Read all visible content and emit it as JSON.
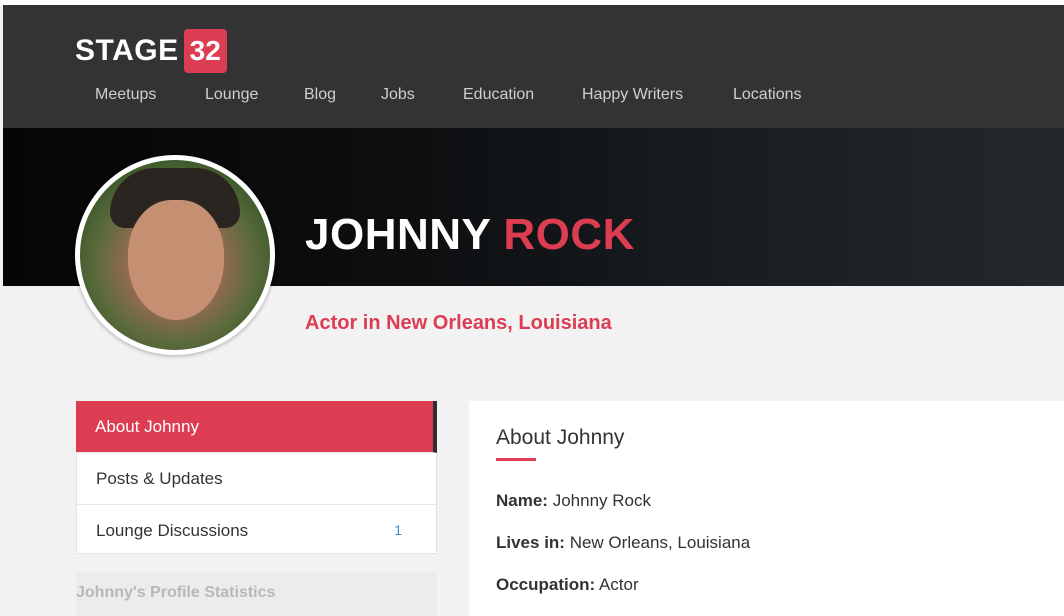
{
  "brand": {
    "word": "STAGE",
    "number": "32",
    "accent": "#dc3d52"
  },
  "nav": [
    "Meetups",
    "Lounge",
    "Blog",
    "Jobs",
    "Education",
    "Happy Writers",
    "Locations"
  ],
  "profile": {
    "first_name": "JOHNNY",
    "last_name": "ROCK",
    "tagline": "Actor in New Orleans, Louisiana"
  },
  "sidebar": {
    "items": [
      {
        "label": "About Johnny",
        "count": ""
      },
      {
        "label": "Posts & Updates",
        "count": ""
      },
      {
        "label": "Lounge Discussions",
        "count": "1"
      }
    ],
    "stats_title": "Johnny's Profile Statistics"
  },
  "about": {
    "title": "About Johnny",
    "rows": [
      {
        "label": "Name:",
        "value": "Johnny Rock"
      },
      {
        "label": "Lives in:",
        "value": "New Orleans, Louisiana"
      },
      {
        "label": "Occupation:",
        "value": "Actor"
      }
    ]
  }
}
